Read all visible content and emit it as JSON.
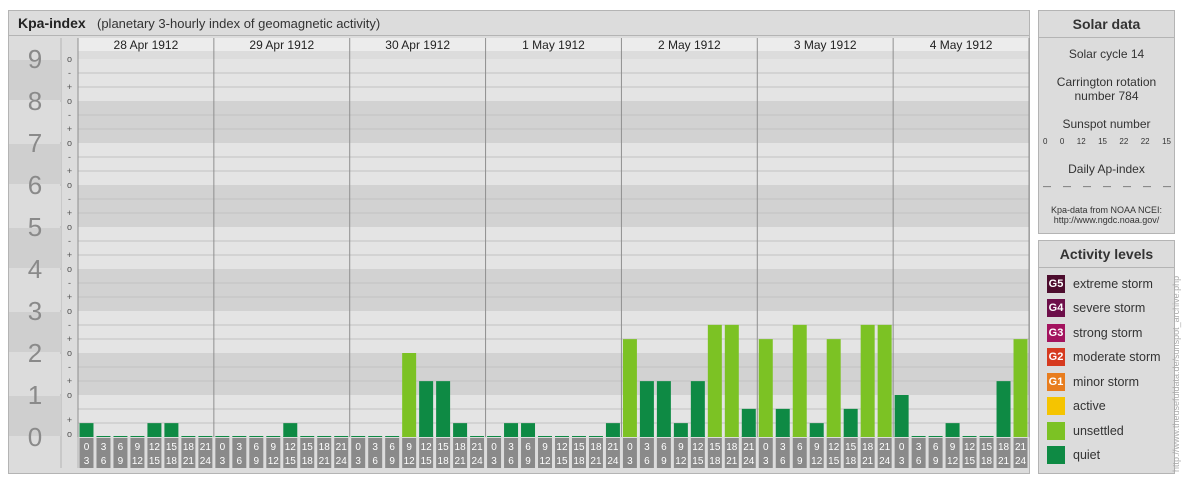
{
  "header": {
    "title": "Kpa-index",
    "subtitle": "(planetary 3-hourly index of geomagnetic activity)"
  },
  "chart_data": {
    "type": "bar",
    "title": "Kpa-index",
    "subtitle": "(planetary 3-hourly index of geomagnetic activity)",
    "ylim": [
      0,
      9
    ],
    "y_ticks": [
      "0",
      "1",
      "2",
      "3",
      "4",
      "5",
      "6",
      "7",
      "8",
      "9"
    ],
    "sub_tick_labels": [
      "+",
      "o",
      "-"
    ],
    "days": [
      "28 Apr 1912",
      "29 Apr 1912",
      "30 Apr 1912",
      "1 May 1912",
      "2 May 1912",
      "3 May 1912",
      "4 May 1912"
    ],
    "interval_start_labels": [
      "0",
      "3",
      "6",
      "9",
      "12",
      "15",
      "18",
      "21"
    ],
    "interval_end_labels": [
      "3",
      "6",
      "9",
      "12",
      "15",
      "18",
      "21",
      "24"
    ],
    "values": [
      [
        0.33,
        0,
        0,
        0,
        0.33,
        0.33,
        0,
        0
      ],
      [
        0,
        0,
        0,
        0,
        0.33,
        0,
        0,
        0
      ],
      [
        0,
        0,
        0,
        2,
        1.33,
        1.33,
        0.33,
        0
      ],
      [
        0,
        0.33,
        0.33,
        0,
        0,
        0,
        0,
        0.33
      ],
      [
        2.33,
        1.33,
        1.33,
        0.33,
        1.33,
        2.67,
        2.67,
        0.67
      ],
      [
        2.33,
        0.67,
        2.67,
        0.33,
        2.33,
        0.67,
        2.67,
        2.67
      ],
      [
        1,
        0,
        0,
        0.33,
        0,
        0,
        1.33,
        2.33
      ]
    ],
    "grid": true,
    "legend": "right panel"
  },
  "solar": {
    "title": "Solar data",
    "cycle": "Solar cycle 14",
    "carrington_line1": "Carrington rotation",
    "carrington_line2": "number 784",
    "sunspot_label": "Sunspot number",
    "sunspot_values": [
      "0",
      "0",
      "12",
      "15",
      "22",
      "22",
      "15"
    ],
    "ap_label": "Daily Ap-index",
    "ap_values": [
      "—",
      "—",
      "—",
      "—",
      "—",
      "—",
      "—"
    ],
    "source_line1": "Kpa-data from NOAA NCEI:",
    "source_line2": "http://www.ngdc.noaa.gov/"
  },
  "levels": {
    "title": "Activity levels",
    "items": [
      {
        "code": "G5",
        "label": "extreme storm",
        "color": "#4d0d2e"
      },
      {
        "code": "G4",
        "label": "severe storm",
        "color": "#6d0f4a"
      },
      {
        "code": "G3",
        "label": "strong storm",
        "color": "#a3135e"
      },
      {
        "code": "G2",
        "label": "moderate storm",
        "color": "#d63a1f"
      },
      {
        "code": "G1",
        "label": "minor storm",
        "color": "#e87d1e"
      },
      {
        "code": "",
        "label": "active",
        "color": "#f5c400"
      },
      {
        "code": "",
        "label": "unsettled",
        "color": "#7cc224"
      },
      {
        "code": "",
        "label": "quiet",
        "color": "#0e8a44"
      }
    ]
  },
  "credit": "http://www.theusefuldata.de/sunspot_archive.php"
}
